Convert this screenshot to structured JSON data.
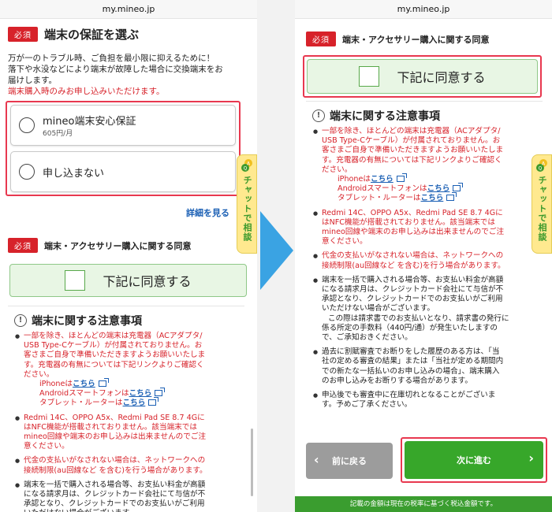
{
  "url": "my.mineo.jp",
  "left": {
    "warranty": {
      "badge": "必須",
      "title": "端末の保証を選ぶ",
      "desc_1": "万が一のトラブル時、ご負担を最小限に抑えるために！",
      "desc_2": "落下や水没などにより端末が故障した場合に交換端末をお",
      "desc_3": "届けします。",
      "note": "端末購入時のみお申し込みいただけます。",
      "options": [
        {
          "label": "mineo端末安心保証",
          "price": "605円/月"
        },
        {
          "label": "申し込まない"
        }
      ],
      "more": "詳細を見る"
    },
    "agreement": {
      "badge": "必須",
      "title": "端末・アクセサリー購入に関する同意",
      "button": "下記に同意する"
    }
  },
  "chat": {
    "badge": "A Q",
    "label": "チャットで相談"
  },
  "notice": {
    "title": "端末に関する注意事項",
    "item1": {
      "l1": "一部を除き、ほとんどの端末は充電器（ACアダプタ/",
      "l2": "USB Type-Cケーブル）が付属されておりません。お",
      "l3": "客さまご自身で準備いただきますようお願いいたしま",
      "l4": "す。充電器の有無については下記リンクよりご確認く",
      "l5": "ださい。",
      "iphone": "iPhoneは",
      "android": "Androidスマートフォンは",
      "tablet": "タブレット・ルーターは",
      "link": "こちら"
    },
    "item2": {
      "l1": "Redmi 14C、OPPO A5x、Redmi Pad SE 8.7 4Gに",
      "l2": "はNFC機能が搭載されておりません。該当端末では",
      "l3": "mineo回線や端末のお申し込みは出来ませんのでご注",
      "l4": "意ください。"
    },
    "item3": {
      "l1": "代金の支払いがなされない場合は、ネットワークへの",
      "l2": "接続制限(au回線など を含む)を行う場合があります。"
    },
    "item4": {
      "l1": "端末を一括で購入される場合等、お支払い料金が高額",
      "l2": "になる請求月は、クレジットカード会社にて与信が不",
      "l3": "承認となり、クレジットカードでのお支払いがご利用",
      "l4": "いただけない場合がございます。",
      "l5": "この際は請求書でのお支払いとなり、請求書の発行に",
      "l6": "係る所定の手数料（440円/通）が発生いたしますの",
      "l7": "で、ご承知おきください。"
    },
    "item5": {
      "l1": "過去に割賦審査でお断りをした履歴のある方は、「当",
      "l2": "社の定める審査の結果」または「当社が定める期間内",
      "l3": "での新たな一括払いのお申し込みの場合」、端末購入",
      "l4": "のお申し込みをお断りする場合があります。"
    },
    "item6": {
      "l1": "申込後でも審査中に在庫切れとなることがございま",
      "l2": "す。予めご了承ください。"
    }
  },
  "right": {
    "badge": "必須",
    "title": "端末・アクセサリー購入に関する同意",
    "button": "下記に同意する",
    "back": "前に戻る",
    "next": "次に進む",
    "footer": "記載の金額は現在の税率に基づく税込金額です。"
  }
}
